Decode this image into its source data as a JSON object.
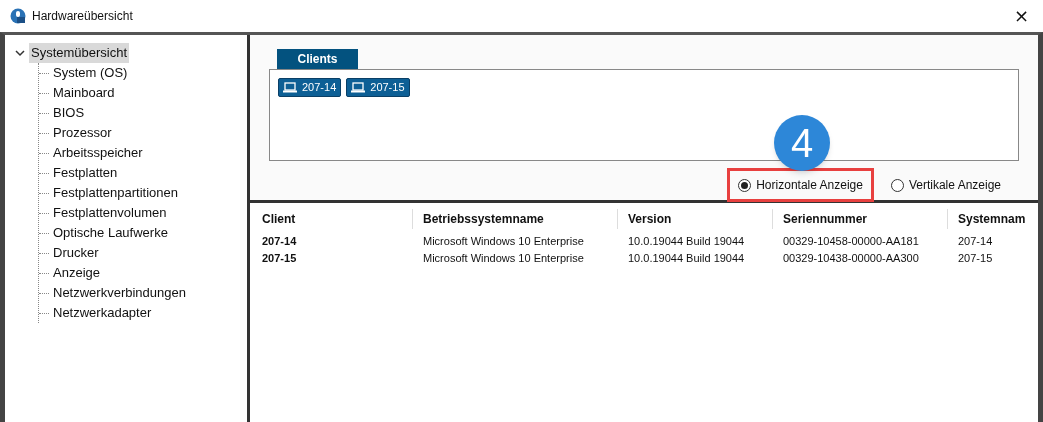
{
  "window": {
    "title": "Hardwareübersicht",
    "close": "×"
  },
  "tree": {
    "label": "Systemübersicht",
    "expanded": true,
    "selected": true,
    "children": [
      {
        "label": "System (OS)",
        "selected": false
      },
      {
        "label": "Mainboard",
        "selected": false
      },
      {
        "label": "BIOS",
        "selected": false
      },
      {
        "label": "Prozessor",
        "selected": false
      },
      {
        "label": "Arbeitsspeicher",
        "selected": false
      },
      {
        "label": "Festplatten",
        "selected": false
      },
      {
        "label": "Festplattenpartitionen",
        "selected": false
      },
      {
        "label": "Festplattenvolumen",
        "selected": false
      },
      {
        "label": "Optische Laufwerke",
        "selected": false
      },
      {
        "label": "Drucker",
        "selected": false
      },
      {
        "label": "Anzeige",
        "selected": false
      },
      {
        "label": "Netzwerkverbindungen",
        "selected": false
      },
      {
        "label": "Netzwerkadapter",
        "selected": false
      }
    ]
  },
  "clients_tab": {
    "label": "Clients"
  },
  "clients": [
    "207-14",
    "207-15"
  ],
  "callout": {
    "number": "4"
  },
  "view_options": [
    {
      "label": "Horizontale Anzeige",
      "selected": true,
      "highlighted": true
    },
    {
      "label": "Vertikale Anzeige",
      "selected": false,
      "highlighted": false
    }
  ],
  "table": {
    "columns": [
      "Client",
      "Betriebssystemname",
      "Version",
      "Seriennummer",
      "Systemnam"
    ],
    "rows": [
      [
        "207-14",
        "Microsoft Windows 10 Enterprise",
        "10.0.19044 Build 19044",
        "00329-10458-00000-AA181",
        "207-14"
      ],
      [
        "207-15",
        "Microsoft Windows 10 Enterprise",
        "10.0.19044 Build 19044",
        "00329-10438-00000-AA300",
        "207-15"
      ]
    ]
  }
}
